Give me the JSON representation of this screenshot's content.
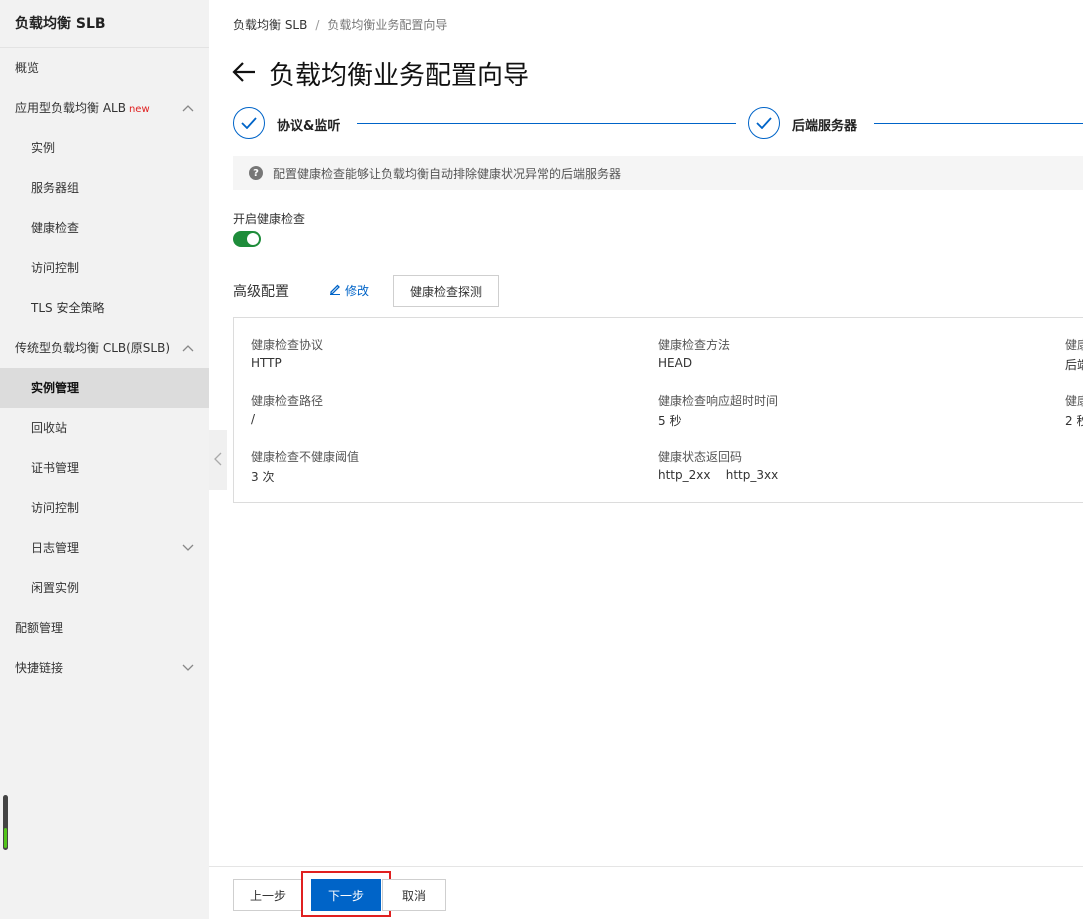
{
  "sidebar": {
    "title": "负载均衡 SLB",
    "items": [
      {
        "label": "概览",
        "level": 1
      },
      {
        "label": "应用型负载均衡 ALB",
        "badge": "new",
        "level": 1,
        "chevron": "up"
      },
      {
        "label": "实例",
        "level": 2
      },
      {
        "label": "服务器组",
        "level": 2
      },
      {
        "label": "健康检查",
        "level": 2
      },
      {
        "label": "访问控制",
        "level": 2
      },
      {
        "label": "TLS 安全策略",
        "level": 2
      },
      {
        "label": "传统型负载均衡 CLB(原SLB)",
        "level": 1,
        "chevron": "up"
      },
      {
        "label": "实例管理",
        "level": 2,
        "active": true
      },
      {
        "label": "回收站",
        "level": 2
      },
      {
        "label": "证书管理",
        "level": 2
      },
      {
        "label": "访问控制",
        "level": 2
      },
      {
        "label": "日志管理",
        "level": 2,
        "chevron": "down"
      },
      {
        "label": "闲置实例",
        "level": 2
      },
      {
        "label": "配额管理",
        "level": 1
      },
      {
        "label": "快捷链接",
        "level": 1,
        "chevron": "down"
      }
    ]
  },
  "breadcrumb": {
    "root": "负载均衡 SLB",
    "separator": "/",
    "current": "负载均衡业务配置向导"
  },
  "page_title": "负载均衡业务配置向导",
  "steps": [
    {
      "label": "协议&监听",
      "status": "done"
    },
    {
      "label": "后端服务器",
      "status": "done"
    }
  ],
  "info": {
    "text": "配置健康检查能够让负载均衡自动排除健康状况异常的后端服务器",
    "icon": "question-icon"
  },
  "health_check": {
    "toggle_label": "开启健康检查",
    "enabled": true,
    "advanced_title": "高级配置",
    "edit_label": "修改",
    "probe_button": "健康检查探测",
    "fields": [
      {
        "label": "健康检查协议",
        "value": "HTTP"
      },
      {
        "label": "健康检查方法",
        "value": "HEAD"
      },
      {
        "label": "健康",
        "value": "后端"
      },
      {
        "label": "健康检查路径",
        "value": "/"
      },
      {
        "label": "健康检查响应超时时间",
        "value": "5 秒"
      },
      {
        "label": "健康",
        "value": "2 秒"
      },
      {
        "label": "健康检查不健康阈值",
        "value": "3 次"
      },
      {
        "label": "健康状态返回码",
        "value": "http_2xx    http_3xx"
      }
    ]
  },
  "footer": {
    "prev": "上一步",
    "next": "下一步",
    "cancel": "取消"
  },
  "colors": {
    "primary": "#0064c8",
    "toggle_on": "#1e8c3a",
    "highlight": "#e02020"
  }
}
